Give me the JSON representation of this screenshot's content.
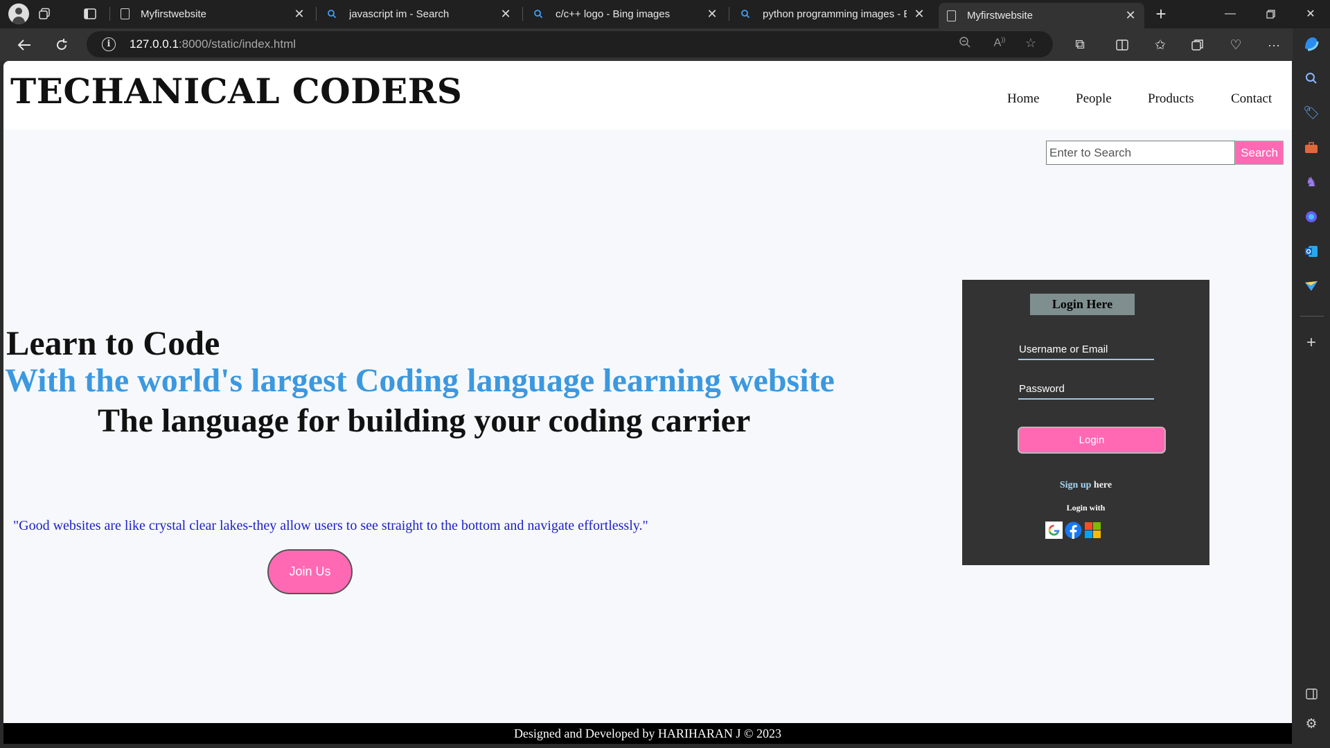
{
  "browser": {
    "tabs": [
      {
        "title": "Myfirstwebsite",
        "icon": "page-icon",
        "active": false
      },
      {
        "title": "javascript im - Search",
        "icon": "bing-search-icon",
        "active": false
      },
      {
        "title": "c/c++ logo - Bing images",
        "icon": "bing-search-icon",
        "active": false
      },
      {
        "title": "python programming images - B",
        "icon": "bing-search-icon",
        "active": false
      },
      {
        "title": "Myfirstwebsite",
        "icon": "page-icon",
        "active": true
      }
    ],
    "address": {
      "host": "127.0.0.1",
      "path": ":8000/static/index.html"
    }
  },
  "site": {
    "brand": "TECHANICAL CODERS",
    "nav": [
      "Home",
      "People",
      "Products",
      "Contact"
    ],
    "search": {
      "placeholder": "Enter to Search",
      "button": "Search"
    },
    "hero": {
      "line1": "Learn to Code",
      "line2": "With the world's largest Coding language learning website",
      "line3": "The language for building your coding carrier"
    },
    "quote": "\"Good websites are like crystal clear lakes-they allow users to see straight to the bottom and navigate effortlessly.\"",
    "join_button": "Join Us",
    "login": {
      "title": "Login Here",
      "username_placeholder": "Username or Email",
      "password_placeholder": "Password",
      "button": "Login",
      "signup_link": "Sign up",
      "signup_rest": " here",
      "login_with": "Login with",
      "providers": [
        "google-icon",
        "facebook-icon",
        "microsoft-icon"
      ]
    },
    "footer": "Designed and Developed by HARIHARAN J © 2023"
  },
  "colors": {
    "accent_pink": "#ff69b4",
    "hero_blue": "#3c98df",
    "quote_blue": "#2020c8",
    "card_bg": "#333333",
    "page_bg": "#f6f8fb"
  }
}
